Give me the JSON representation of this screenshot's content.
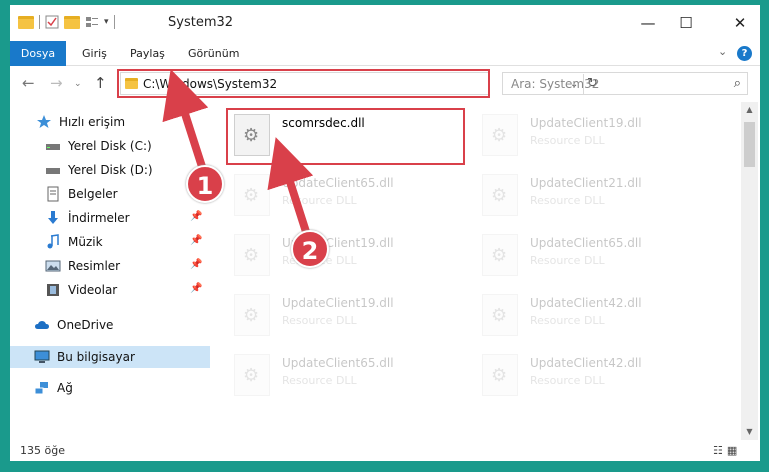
{
  "window": {
    "title": "System32"
  },
  "ribbon": {
    "tabs": [
      {
        "label": "Dosya",
        "active": true
      },
      {
        "label": "Giriş"
      },
      {
        "label": "Paylaş"
      },
      {
        "label": "Görünüm"
      }
    ],
    "help": "?"
  },
  "nav": {
    "address": "C:\\Windows\\System32",
    "search_placeholder": "Ara: System32"
  },
  "sidebar": {
    "items": [
      {
        "label": "Hızlı erişim",
        "icon": "star-icon"
      },
      {
        "label": "Yerel Disk (C:)",
        "icon": "drive-icon"
      },
      {
        "label": "Yerel Disk (D:)",
        "icon": "drive-icon"
      },
      {
        "label": "Belgeler",
        "icon": "documents-icon"
      },
      {
        "label": "İndirmeler",
        "icon": "download-icon",
        "pinned": true
      },
      {
        "label": "Müzik",
        "icon": "music-icon",
        "pinned": true
      },
      {
        "label": "Resimler",
        "icon": "pictures-icon",
        "pinned": true
      },
      {
        "label": "Videolar",
        "icon": "videos-icon",
        "pinned": true
      },
      {
        "label": "OneDrive",
        "icon": "cloud-icon"
      },
      {
        "label": "Bu bilgisayar",
        "icon": "computer-icon",
        "selected": true
      },
      {
        "label": "Ağ",
        "icon": "network-icon"
      }
    ]
  },
  "files": [
    {
      "name": "scomrsdec.dll",
      "type": "",
      "highlight": true
    },
    {
      "name": "UpdateClient19.dll",
      "type": "Resource DLL"
    },
    {
      "name": "UpdateClient65.dll",
      "type": "Resource DLL"
    },
    {
      "name": "UpdateClient21.dll",
      "type": "Resource DLL"
    },
    {
      "name": "UpdateClient19.dll",
      "type": "Resource DLL"
    },
    {
      "name": "UpdateClient65.dll",
      "type": "Resource DLL"
    },
    {
      "name": "UpdateClient19.dll",
      "type": "Resource DLL"
    },
    {
      "name": "UpdateClient42.dll",
      "type": "Resource DLL"
    },
    {
      "name": "UpdateClient65.dll",
      "type": "Resource DLL"
    },
    {
      "name": "UpdateClient42.dll",
      "type": "Resource DLL"
    }
  ],
  "status": {
    "count": "135 öğe"
  },
  "annotations": {
    "badge1": "1",
    "badge2": "2",
    "color": "#d9404a"
  }
}
